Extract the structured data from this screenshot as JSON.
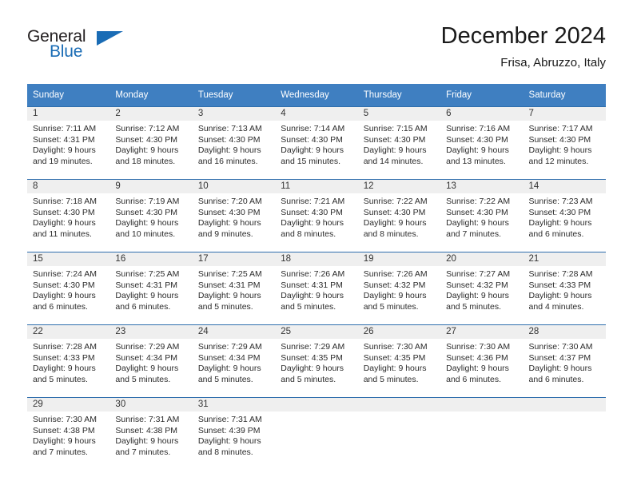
{
  "logo": {
    "name_top": "General",
    "name_bottom": "Blue",
    "triangle_color": "#1a6cb5",
    "text_color": "#231f20"
  },
  "header": {
    "title": "December 2024",
    "subtitle": "Frisa, Abruzzo, Italy"
  },
  "theme": {
    "header_bg": "#3f7fc1",
    "row_divider": "#2f6ead",
    "date_band": "#efefef"
  },
  "weekdays": [
    "Sunday",
    "Monday",
    "Tuesday",
    "Wednesday",
    "Thursday",
    "Friday",
    "Saturday"
  ],
  "weeks": [
    [
      {
        "date": "1",
        "sunrise": "Sunrise: 7:11 AM",
        "sunset": "Sunset: 4:31 PM",
        "daylight1": "Daylight: 9 hours",
        "daylight2": "and 19 minutes."
      },
      {
        "date": "2",
        "sunrise": "Sunrise: 7:12 AM",
        "sunset": "Sunset: 4:30 PM",
        "daylight1": "Daylight: 9 hours",
        "daylight2": "and 18 minutes."
      },
      {
        "date": "3",
        "sunrise": "Sunrise: 7:13 AM",
        "sunset": "Sunset: 4:30 PM",
        "daylight1": "Daylight: 9 hours",
        "daylight2": "and 16 minutes."
      },
      {
        "date": "4",
        "sunrise": "Sunrise: 7:14 AM",
        "sunset": "Sunset: 4:30 PM",
        "daylight1": "Daylight: 9 hours",
        "daylight2": "and 15 minutes."
      },
      {
        "date": "5",
        "sunrise": "Sunrise: 7:15 AM",
        "sunset": "Sunset: 4:30 PM",
        "daylight1": "Daylight: 9 hours",
        "daylight2": "and 14 minutes."
      },
      {
        "date": "6",
        "sunrise": "Sunrise: 7:16 AM",
        "sunset": "Sunset: 4:30 PM",
        "daylight1": "Daylight: 9 hours",
        "daylight2": "and 13 minutes."
      },
      {
        "date": "7",
        "sunrise": "Sunrise: 7:17 AM",
        "sunset": "Sunset: 4:30 PM",
        "daylight1": "Daylight: 9 hours",
        "daylight2": "and 12 minutes."
      }
    ],
    [
      {
        "date": "8",
        "sunrise": "Sunrise: 7:18 AM",
        "sunset": "Sunset: 4:30 PM",
        "daylight1": "Daylight: 9 hours",
        "daylight2": "and 11 minutes."
      },
      {
        "date": "9",
        "sunrise": "Sunrise: 7:19 AM",
        "sunset": "Sunset: 4:30 PM",
        "daylight1": "Daylight: 9 hours",
        "daylight2": "and 10 minutes."
      },
      {
        "date": "10",
        "sunrise": "Sunrise: 7:20 AM",
        "sunset": "Sunset: 4:30 PM",
        "daylight1": "Daylight: 9 hours",
        "daylight2": "and 9 minutes."
      },
      {
        "date": "11",
        "sunrise": "Sunrise: 7:21 AM",
        "sunset": "Sunset: 4:30 PM",
        "daylight1": "Daylight: 9 hours",
        "daylight2": "and 8 minutes."
      },
      {
        "date": "12",
        "sunrise": "Sunrise: 7:22 AM",
        "sunset": "Sunset: 4:30 PM",
        "daylight1": "Daylight: 9 hours",
        "daylight2": "and 8 minutes."
      },
      {
        "date": "13",
        "sunrise": "Sunrise: 7:22 AM",
        "sunset": "Sunset: 4:30 PM",
        "daylight1": "Daylight: 9 hours",
        "daylight2": "and 7 minutes."
      },
      {
        "date": "14",
        "sunrise": "Sunrise: 7:23 AM",
        "sunset": "Sunset: 4:30 PM",
        "daylight1": "Daylight: 9 hours",
        "daylight2": "and 6 minutes."
      }
    ],
    [
      {
        "date": "15",
        "sunrise": "Sunrise: 7:24 AM",
        "sunset": "Sunset: 4:30 PM",
        "daylight1": "Daylight: 9 hours",
        "daylight2": "and 6 minutes."
      },
      {
        "date": "16",
        "sunrise": "Sunrise: 7:25 AM",
        "sunset": "Sunset: 4:31 PM",
        "daylight1": "Daylight: 9 hours",
        "daylight2": "and 6 minutes."
      },
      {
        "date": "17",
        "sunrise": "Sunrise: 7:25 AM",
        "sunset": "Sunset: 4:31 PM",
        "daylight1": "Daylight: 9 hours",
        "daylight2": "and 5 minutes."
      },
      {
        "date": "18",
        "sunrise": "Sunrise: 7:26 AM",
        "sunset": "Sunset: 4:31 PM",
        "daylight1": "Daylight: 9 hours",
        "daylight2": "and 5 minutes."
      },
      {
        "date": "19",
        "sunrise": "Sunrise: 7:26 AM",
        "sunset": "Sunset: 4:32 PM",
        "daylight1": "Daylight: 9 hours",
        "daylight2": "and 5 minutes."
      },
      {
        "date": "20",
        "sunrise": "Sunrise: 7:27 AM",
        "sunset": "Sunset: 4:32 PM",
        "daylight1": "Daylight: 9 hours",
        "daylight2": "and 5 minutes."
      },
      {
        "date": "21",
        "sunrise": "Sunrise: 7:28 AM",
        "sunset": "Sunset: 4:33 PM",
        "daylight1": "Daylight: 9 hours",
        "daylight2": "and 4 minutes."
      }
    ],
    [
      {
        "date": "22",
        "sunrise": "Sunrise: 7:28 AM",
        "sunset": "Sunset: 4:33 PM",
        "daylight1": "Daylight: 9 hours",
        "daylight2": "and 5 minutes."
      },
      {
        "date": "23",
        "sunrise": "Sunrise: 7:29 AM",
        "sunset": "Sunset: 4:34 PM",
        "daylight1": "Daylight: 9 hours",
        "daylight2": "and 5 minutes."
      },
      {
        "date": "24",
        "sunrise": "Sunrise: 7:29 AM",
        "sunset": "Sunset: 4:34 PM",
        "daylight1": "Daylight: 9 hours",
        "daylight2": "and 5 minutes."
      },
      {
        "date": "25",
        "sunrise": "Sunrise: 7:29 AM",
        "sunset": "Sunset: 4:35 PM",
        "daylight1": "Daylight: 9 hours",
        "daylight2": "and 5 minutes."
      },
      {
        "date": "26",
        "sunrise": "Sunrise: 7:30 AM",
        "sunset": "Sunset: 4:35 PM",
        "daylight1": "Daylight: 9 hours",
        "daylight2": "and 5 minutes."
      },
      {
        "date": "27",
        "sunrise": "Sunrise: 7:30 AM",
        "sunset": "Sunset: 4:36 PM",
        "daylight1": "Daylight: 9 hours",
        "daylight2": "and 6 minutes."
      },
      {
        "date": "28",
        "sunrise": "Sunrise: 7:30 AM",
        "sunset": "Sunset: 4:37 PM",
        "daylight1": "Daylight: 9 hours",
        "daylight2": "and 6 minutes."
      }
    ],
    [
      {
        "date": "29",
        "sunrise": "Sunrise: 7:30 AM",
        "sunset": "Sunset: 4:38 PM",
        "daylight1": "Daylight: 9 hours",
        "daylight2": "and 7 minutes."
      },
      {
        "date": "30",
        "sunrise": "Sunrise: 7:31 AM",
        "sunset": "Sunset: 4:38 PM",
        "daylight1": "Daylight: 9 hours",
        "daylight2": "and 7 minutes."
      },
      {
        "date": "31",
        "sunrise": "Sunrise: 7:31 AM",
        "sunset": "Sunset: 4:39 PM",
        "daylight1": "Daylight: 9 hours",
        "daylight2": "and 8 minutes."
      },
      {
        "date": "",
        "sunrise": "",
        "sunset": "",
        "daylight1": "",
        "daylight2": ""
      },
      {
        "date": "",
        "sunrise": "",
        "sunset": "",
        "daylight1": "",
        "daylight2": ""
      },
      {
        "date": "",
        "sunrise": "",
        "sunset": "",
        "daylight1": "",
        "daylight2": ""
      },
      {
        "date": "",
        "sunrise": "",
        "sunset": "",
        "daylight1": "",
        "daylight2": ""
      }
    ]
  ]
}
